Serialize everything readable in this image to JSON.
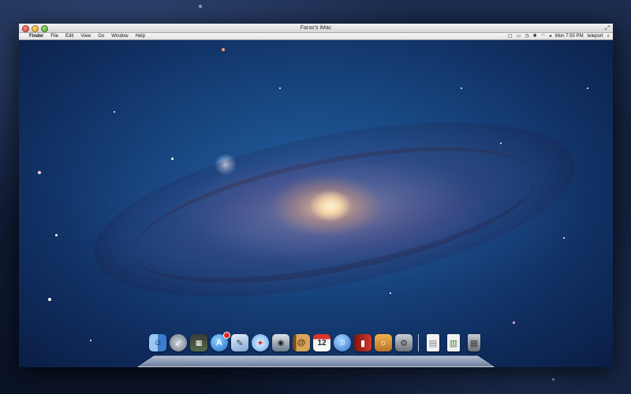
{
  "window": {
    "title": "Faraz's iMac"
  },
  "menubar": {
    "apple_icon": "apple-logo-icon",
    "items": [
      "Finder",
      "File",
      "Edit",
      "View",
      "Go",
      "Window",
      "Help"
    ],
    "status_icons": [
      "screen-sharing-icon",
      "airplay-icon",
      "time-machine-icon",
      "bluetooth-icon",
      "wifi-icon",
      "volume-icon"
    ],
    "clock": "Mon 7:50 PM",
    "user": "teleport",
    "spotlight_icon": "spotlight-search-icon"
  },
  "dock": {
    "calendar_day": "12",
    "apps": [
      {
        "name": "finder-icon",
        "color": "#4a8fd6"
      },
      {
        "name": "launchpad-icon",
        "color": "#8c9aa8"
      },
      {
        "name": "mission-control-icon",
        "color": "#4f7a4a"
      },
      {
        "name": "app-store-icon",
        "color": "#2d8de0"
      },
      {
        "name": "preview-icon",
        "color": "#7da6d6"
      },
      {
        "name": "safari-icon",
        "color": "#5aa4e6"
      },
      {
        "name": "facetime-icon",
        "color": "#6c7a8a"
      },
      {
        "name": "address-book-icon",
        "color": "#b07a3a"
      },
      {
        "name": "calendar-icon",
        "color": "#f2f2f2"
      },
      {
        "name": "itunes-icon",
        "color": "#2f6fd0"
      },
      {
        "name": "photo-booth-icon",
        "color": "#b52a1e"
      },
      {
        "name": "iphoto-icon",
        "color": "#d59a3a"
      },
      {
        "name": "system-preferences-icon",
        "color": "#8d939c"
      }
    ],
    "stacks": [
      {
        "name": "documents-stack-icon",
        "color": "#e8e8e8"
      },
      {
        "name": "downloads-stack-icon",
        "color": "#e8e8e8"
      },
      {
        "name": "trash-icon",
        "color": "#9aa0a8"
      }
    ]
  }
}
